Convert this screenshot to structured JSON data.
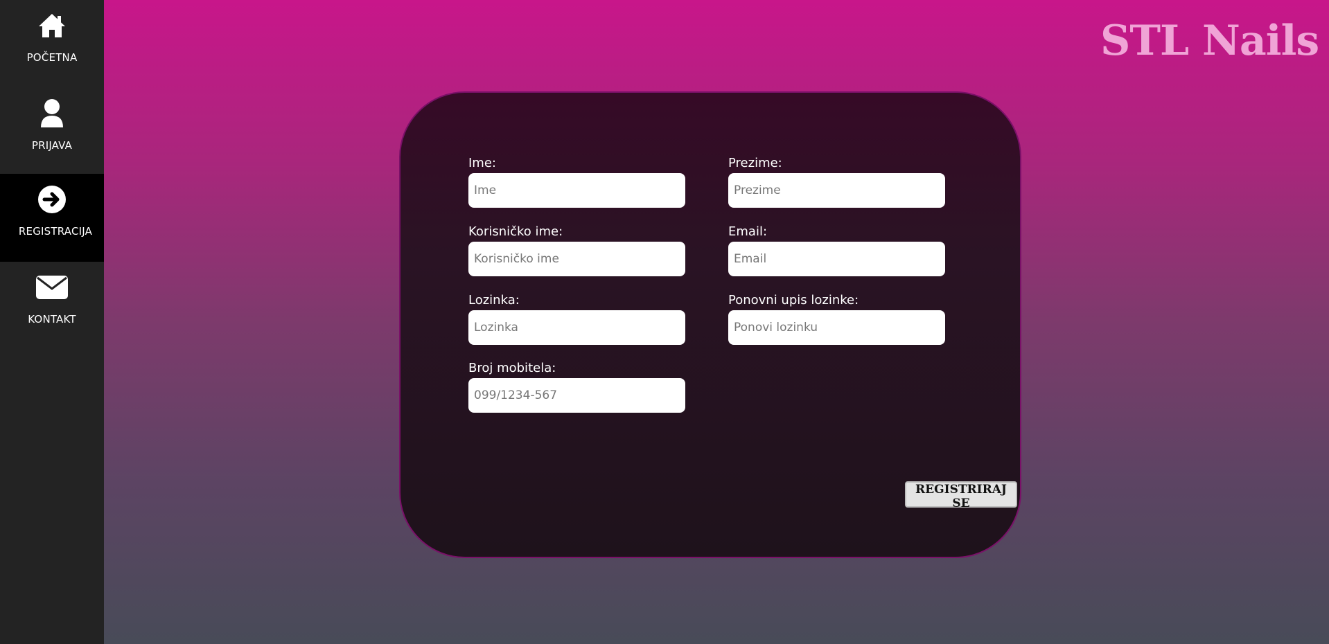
{
  "sidebar": {
    "items": [
      {
        "label": "POČETNA",
        "icon": "home-icon",
        "active": false
      },
      {
        "label": "PRIJAVA",
        "icon": "user-icon",
        "active": false
      },
      {
        "label": "REGISTRACIJA",
        "icon": "arrow-right-circle-icon",
        "active": true
      },
      {
        "label": "KONTAKT",
        "icon": "envelope-icon",
        "active": false
      }
    ]
  },
  "header": {
    "logo_text": "STL Nails"
  },
  "form": {
    "first_name": {
      "label": "Ime:",
      "placeholder": "Ime",
      "value": ""
    },
    "last_name": {
      "label": "Prezime:",
      "placeholder": "Prezime",
      "value": ""
    },
    "username": {
      "label": "Korisničko ime:",
      "placeholder": "Korisničko ime",
      "value": ""
    },
    "email": {
      "label": "Email:",
      "placeholder": "Email",
      "value": ""
    },
    "password": {
      "label": "Lozinka:",
      "placeholder": "Lozinka",
      "value": ""
    },
    "password_repeat": {
      "label": "Ponovni upis lozinke:",
      "placeholder": "Ponovi lozinku",
      "value": ""
    },
    "phone": {
      "label": "Broj mobitela:",
      "placeholder": "099/1234-567",
      "value": ""
    },
    "submit_label": "REGISTRIRAJ SE"
  },
  "colors": {
    "sidebar_bg": "#232323",
    "sidebar_active_bg": "#000000",
    "gradient_top": "#c8168a",
    "gradient_bottom": "#484b58",
    "logo": "#f0a4d6",
    "card_bg": "#2a1324"
  }
}
